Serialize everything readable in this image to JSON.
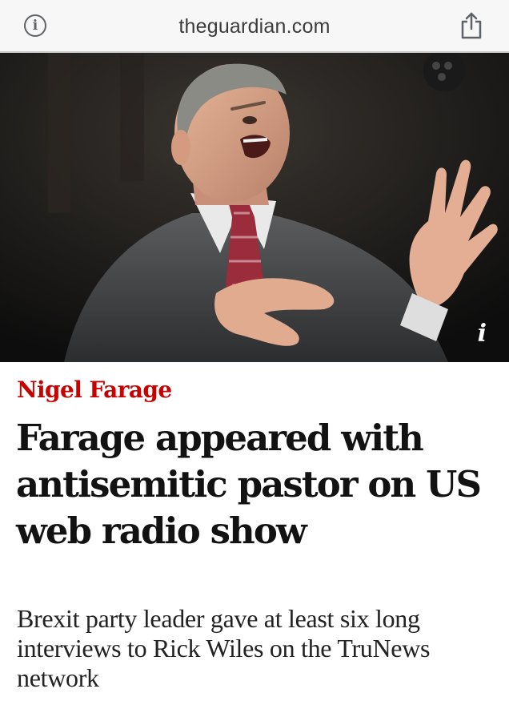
{
  "browser": {
    "url": "theguardian.com",
    "info_icon": "info-circle-icon",
    "share_icon": "share-icon"
  },
  "hero_image": {
    "caption_icon": "i"
  },
  "article": {
    "kicker": "Nigel Farage",
    "headline": "Farage appeared with antisemitic pastor on US web radio show",
    "standfirst": "Brexit party leader gave at least six long interviews to Rick Wiles on the TruNews network"
  },
  "colors": {
    "kicker": "#c70000",
    "headline": "#121212",
    "toolbar": "#f7f7f7"
  }
}
